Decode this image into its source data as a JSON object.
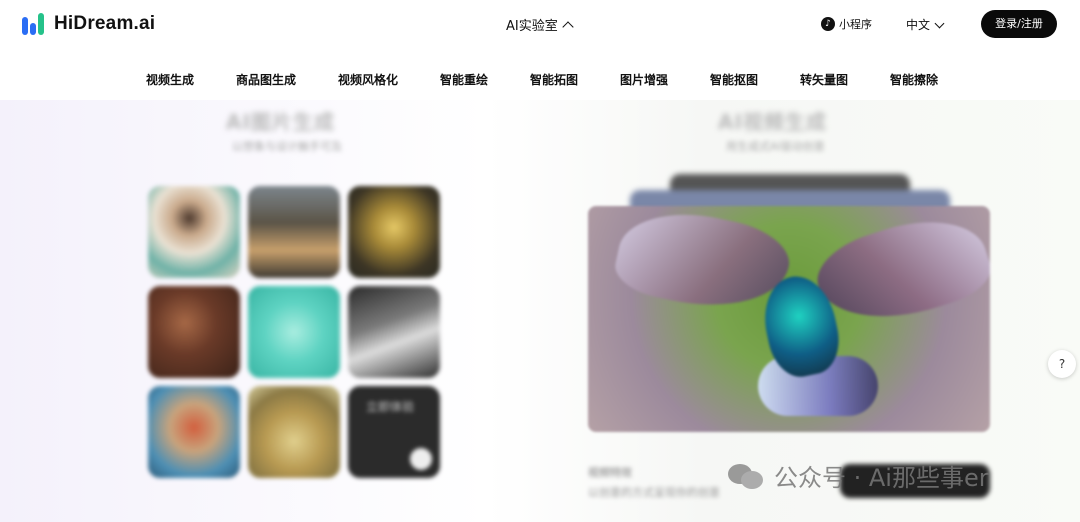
{
  "header": {
    "logo_text": "HiDream.ai",
    "lab_label": "AI实验室",
    "mini_program_label": "小程序",
    "language_label": "中文",
    "login_label": "登录/注册"
  },
  "nav": {
    "items": [
      "视频生成",
      "商品图生成",
      "视频风格化",
      "智能重绘",
      "智能拓图",
      "图片增强",
      "智能抠图",
      "转矢量图",
      "智能擦除"
    ]
  },
  "content": {
    "left_heading": "AI图片生成",
    "left_sub": "以想象与设计触手可及",
    "grid_tile_label": "立即体验",
    "right_heading": "AI视频生成",
    "right_sub": "用生成式AI驱动创意",
    "right_caption": "视频特效",
    "right_caption_sub": "以创意的方式呈现你的创意"
  },
  "watermark": "公众号 · Ai那些事er",
  "colors": {
    "accent_blue": "#2a6df4",
    "accent_green": "#25c28a",
    "login_bg": "#0a0a0a"
  }
}
